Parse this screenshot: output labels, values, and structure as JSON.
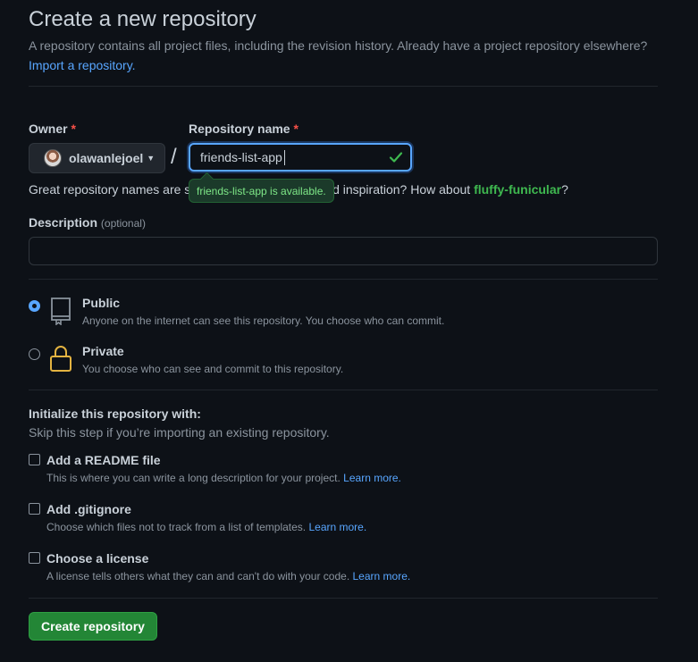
{
  "header": {
    "title": "Create a new repository",
    "subtitle": "A repository contains all project files, including the revision history. Already have a project repository elsewhere?",
    "import_link": "Import a repository."
  },
  "owner": {
    "label": "Owner",
    "required_mark": "*",
    "value": "olawanlejoel",
    "caret_icon": "caret-down-icon"
  },
  "separator": "/",
  "repo_name": {
    "label": "Repository name",
    "required_mark": "*",
    "value": "friends-list-app",
    "valid_color": "#3fb950",
    "tooltip": "friends-list-app is available."
  },
  "name_hint": {
    "prefix": "Great repository names are sh",
    "hidden_part": "ort and memorable. Need inspiration? How about ",
    "suffix_before": "d inspiration? How about ",
    "suggestion": "fluffy-funicular",
    "end": "?"
  },
  "description": {
    "label": "Description",
    "optional": "(optional)",
    "value": ""
  },
  "visibility": {
    "options": [
      {
        "title": "Public",
        "note": "Anyone on the internet can see this repository. You choose who can commit.",
        "checked": true,
        "icon": "repo-icon"
      },
      {
        "title": "Private",
        "note": "You choose who can see and commit to this repository.",
        "checked": false,
        "icon": "lock-icon"
      }
    ]
  },
  "initialize": {
    "title": "Initialize this repository with:",
    "subtitle": "Skip this step if you’re importing an existing repository.",
    "items": [
      {
        "title": "Add a README file",
        "note": "This is where you can write a long description for your project.",
        "link": "Learn more."
      },
      {
        "title": "Add .gitignore",
        "note": "Choose which files not to track from a list of templates.",
        "link": "Learn more."
      },
      {
        "title": "Choose a license",
        "note": "A license tells others what they can and can't do with your code.",
        "link": "Learn more."
      }
    ]
  },
  "submit": {
    "label": "Create repository",
    "color": "#238636"
  }
}
